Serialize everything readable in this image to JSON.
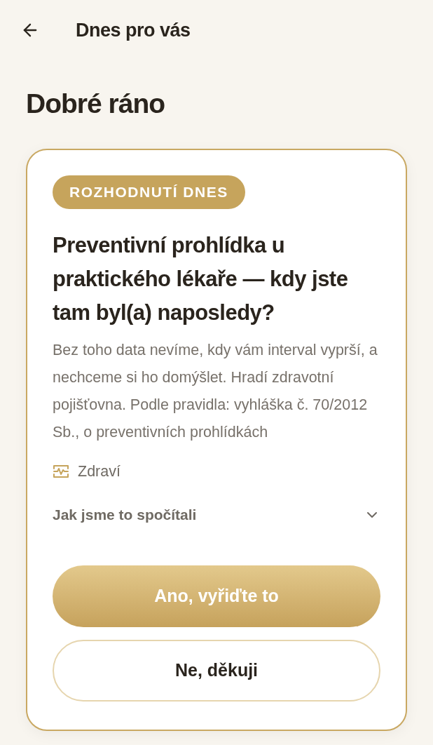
{
  "header": {
    "title": "Dnes pro vás"
  },
  "greeting": "Dobré ráno",
  "card": {
    "badge": "ROZHODNUTÍ DNES",
    "title": "Preventivní prohlídka u praktického lékaře — kdy jste tam byl(a) naposledy?",
    "body": "Bez toho data nevíme, kdy vám interval vyprší, a nechceme si ho domýšlet. Hradí zdravotní pojišťovna. Podle pravidla: vyhláška č. 70/2012 Sb., o preventivních prohlídkách",
    "category": "Zdraví",
    "explainer": {
      "label": "Jak jsme to spočítali",
      "expanded": false
    },
    "buttons": [
      {
        "label": "Ano, vyřiďte to",
        "kind": "primary"
      },
      {
        "label": "Ne, děkuji",
        "kind": "secondary"
      }
    ]
  }
}
